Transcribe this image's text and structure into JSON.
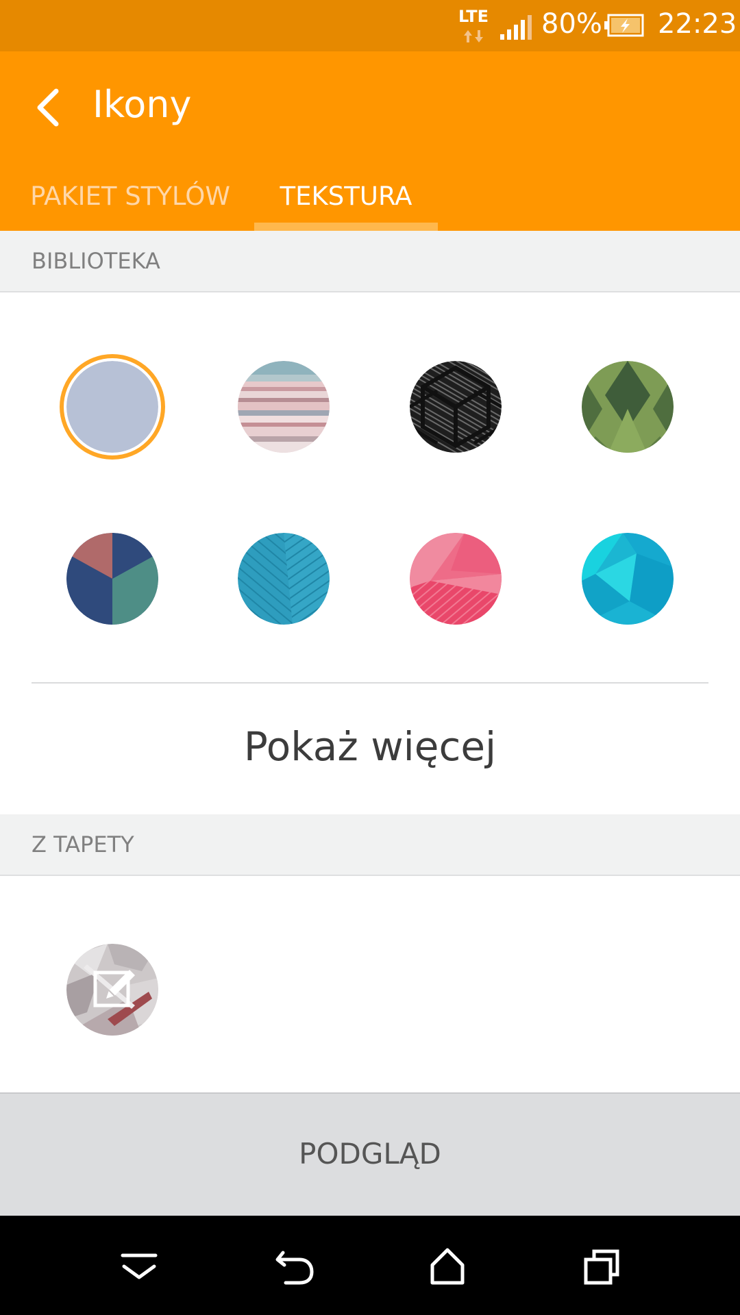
{
  "status_bar": {
    "network": "LTE",
    "battery_percent": "80%",
    "time": "22:23",
    "icons": [
      "lte-icon",
      "signal-icon",
      "battery-charging-icon"
    ]
  },
  "app_bar": {
    "title": "Ikony",
    "back_icon": "chevron-left-icon",
    "tabs": [
      {
        "label": "PAKIET STYLÓW",
        "selected": false
      },
      {
        "label": "TEKSTURA",
        "selected": true
      }
    ]
  },
  "library": {
    "header": "BIBLIOTEKA",
    "selected_index": 0,
    "swatches": [
      {
        "name": "lavender-plain"
      },
      {
        "name": "pastel-stripes"
      },
      {
        "name": "black-geometric"
      },
      {
        "name": "green-diamonds"
      },
      {
        "name": "navy-teal-pie"
      },
      {
        "name": "teal-lines"
      },
      {
        "name": "pink-facets"
      },
      {
        "name": "cyan-polygons"
      }
    ],
    "show_more": "Pokaż więcej"
  },
  "wallpaper": {
    "header": "Z TAPETY",
    "edit_icon": "edit-icon"
  },
  "preview_button": "PODGLĄD",
  "nav_bar": {
    "icons": [
      "dropdown-icon",
      "back-icon",
      "home-icon",
      "recents-icon"
    ]
  },
  "colors": {
    "status_bar": "#E68900",
    "app_bar": "#FF9600",
    "selected_ring": "#FFA726",
    "section_header_bg": "#F1F2F2"
  }
}
